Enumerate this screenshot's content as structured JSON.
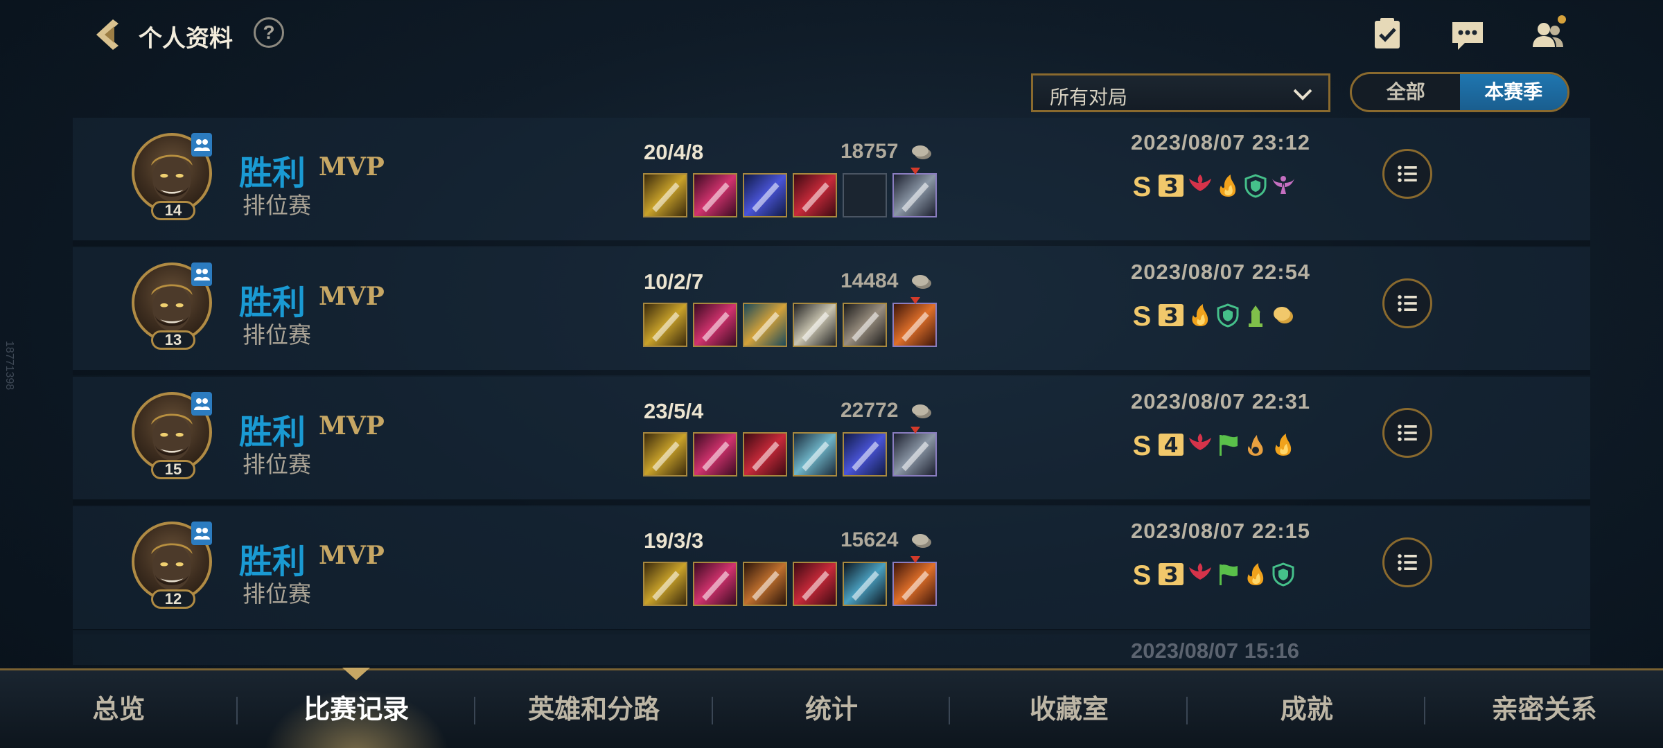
{
  "header": {
    "title": "个人资料",
    "help_label": "?",
    "icons": [
      "back-chevron-icon",
      "help-icon",
      "missions-icon",
      "chat-icon",
      "friends-icon"
    ]
  },
  "filters": {
    "dropdown_value": "所有对局",
    "segment": [
      {
        "label": "全部",
        "active": false
      },
      {
        "label": "本赛季",
        "active": true
      }
    ]
  },
  "side_id": "18771398",
  "matches": [
    {
      "result": "胜利",
      "mvp": "MVP",
      "mode": "排位赛",
      "level": "14",
      "kda": "20/4/8",
      "gold": "18757",
      "date": "2023/08/07 23:12",
      "grade": "S",
      "multikill": "3",
      "items": [
        "lightning-sword-item",
        "crimson-blade-item",
        "azure-spear-item",
        "red-armor-item",
        "empty-slot",
        "stone-trinket-item"
      ],
      "badges": [
        "red-wings-icon",
        "flame-icon",
        "shield-icon",
        "angel-icon"
      ]
    },
    {
      "result": "胜利",
      "mvp": "MVP",
      "mode": "排位赛",
      "level": "13",
      "kda": "10/2/7",
      "gold": "14484",
      "date": "2023/08/07 22:54",
      "grade": "S",
      "multikill": "3",
      "items": [
        "lightning-sword-item",
        "crimson-blade-item",
        "golden-helm-item",
        "steel-sword-item",
        "gauntlet-item",
        "fire-trinket-item"
      ],
      "badges": [
        "flame-icon",
        "shield-icon",
        "tower-icon",
        "gold-coin-icon"
      ]
    },
    {
      "result": "胜利",
      "mvp": "MVP",
      "mode": "排位赛",
      "level": "15",
      "kda": "23/5/4",
      "gold": "22772",
      "date": "2023/08/07 22:31",
      "grade": "S",
      "multikill": "4",
      "items": [
        "lightning-sword-item",
        "crimson-blade-item",
        "red-armor-item",
        "steel-wing-item",
        "azure-spear-item",
        "stone-trinket-item"
      ],
      "badges": [
        "red-wings-icon",
        "flag-icon",
        "hand-flame-icon",
        "flame-icon"
      ]
    },
    {
      "result": "胜利",
      "mvp": "MVP",
      "mode": "排位赛",
      "level": "12",
      "kda": "19/3/3",
      "gold": "15624",
      "date": "2023/08/07 22:15",
      "grade": "S",
      "multikill": "3",
      "items": [
        "lightning-sword-item",
        "crimson-blade-item",
        "bronze-horn-item",
        "red-armor-item",
        "dark-arrow-item",
        "fire-trinket-item"
      ],
      "badges": [
        "red-wings-icon",
        "flag-icon",
        "flame-icon",
        "shield-icon"
      ]
    }
  ],
  "partial_date": "2023/08/07 15:16",
  "nav": [
    {
      "label": "总览",
      "active": false
    },
    {
      "label": "比赛记录",
      "active": true
    },
    {
      "label": "英雄和分路",
      "active": false
    },
    {
      "label": "统计",
      "active": false
    },
    {
      "label": "收藏室",
      "active": false
    },
    {
      "label": "成就",
      "active": false
    },
    {
      "label": "亲密关系",
      "active": false
    }
  ],
  "colors": {
    "victory": "#1a9ad3",
    "mvp": "#c7a764",
    "accent_gold": "#8a6a2e",
    "active_segment": "#1f76b0"
  }
}
